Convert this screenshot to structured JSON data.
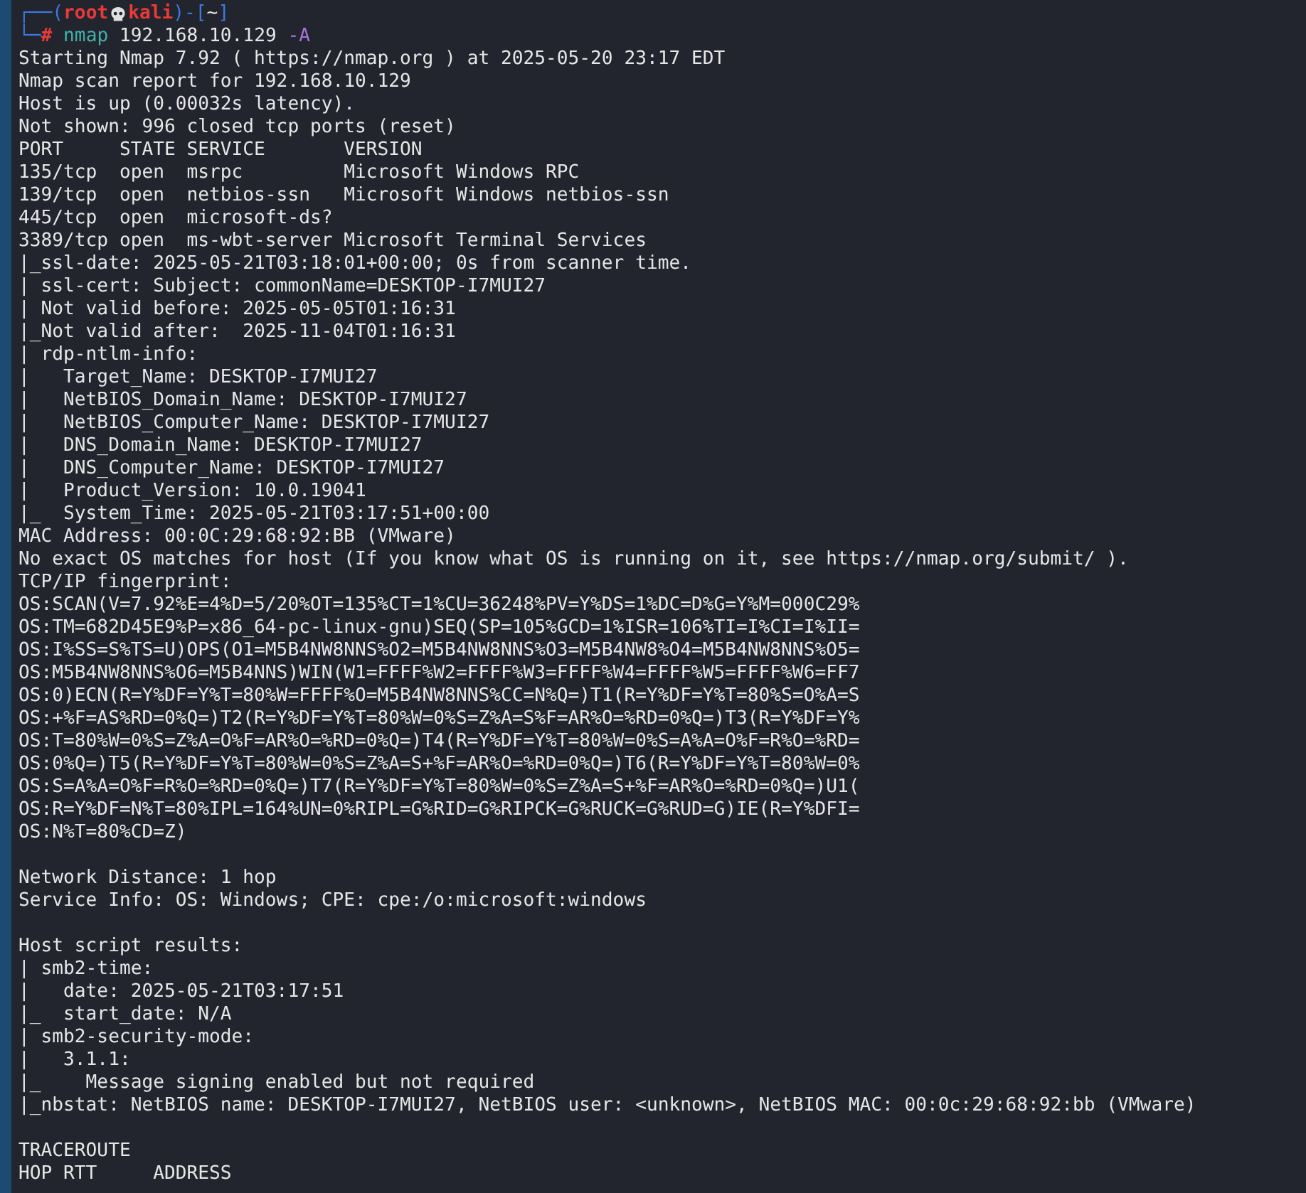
{
  "terminal": {
    "lines": [
      {
        "kind": "prompt",
        "segments": [
          {
            "kind": "frame",
            "text": "┌──("
          },
          {
            "kind": "user",
            "text": "root"
          },
          {
            "kind": "skull"
          },
          {
            "kind": "host",
            "text": "kali"
          },
          {
            "kind": "frame",
            "text": ")-["
          },
          {
            "kind": "directory",
            "text": "~"
          },
          {
            "kind": "frame",
            "text": "]"
          }
        ]
      },
      {
        "kind": "prompt",
        "segments": [
          {
            "kind": "frame",
            "text": "└─"
          },
          {
            "kind": "symbol",
            "text": "#"
          },
          {
            "kind": "program",
            "text": "nmap"
          },
          {
            "kind": "argument",
            "text": "192.168.10.129"
          },
          {
            "kind": "flag",
            "text": "-A"
          }
        ]
      },
      {
        "kind": "output",
        "text": "Starting Nmap 7.92 ( https://nmap.org ) at 2025-05-20 23:17 EDT"
      },
      {
        "kind": "output",
        "text": "Nmap scan report for 192.168.10.129"
      },
      {
        "kind": "output",
        "text": "Host is up (0.00032s latency)."
      },
      {
        "kind": "output",
        "text": "Not shown: 996 closed tcp ports (reset)"
      },
      {
        "kind": "output",
        "text": "PORT     STATE SERVICE       VERSION"
      },
      {
        "kind": "output",
        "text": "135/tcp  open  msrpc         Microsoft Windows RPC"
      },
      {
        "kind": "output",
        "text": "139/tcp  open  netbios-ssn   Microsoft Windows netbios-ssn"
      },
      {
        "kind": "output",
        "text": "445/tcp  open  microsoft-ds?"
      },
      {
        "kind": "output",
        "text": "3389/tcp open  ms-wbt-server Microsoft Terminal Services"
      },
      {
        "kind": "output",
        "text": "|_ssl-date: 2025-05-21T03:18:01+00:00; 0s from scanner time."
      },
      {
        "kind": "output",
        "text": "| ssl-cert: Subject: commonName=DESKTOP-I7MUI27"
      },
      {
        "kind": "output",
        "text": "| Not valid before: 2025-05-05T01:16:31"
      },
      {
        "kind": "output",
        "text": "|_Not valid after:  2025-11-04T01:16:31"
      },
      {
        "kind": "output",
        "text": "| rdp-ntlm-info:"
      },
      {
        "kind": "output",
        "text": "|   Target_Name: DESKTOP-I7MUI27"
      },
      {
        "kind": "output",
        "text": "|   NetBIOS_Domain_Name: DESKTOP-I7MUI27"
      },
      {
        "kind": "output",
        "text": "|   NetBIOS_Computer_Name: DESKTOP-I7MUI27"
      },
      {
        "kind": "output",
        "text": "|   DNS_Domain_Name: DESKTOP-I7MUI27"
      },
      {
        "kind": "output",
        "text": "|   DNS_Computer_Name: DESKTOP-I7MUI27"
      },
      {
        "kind": "output",
        "text": "|   Product_Version: 10.0.19041"
      },
      {
        "kind": "output",
        "text": "|_  System_Time: 2025-05-21T03:17:51+00:00"
      },
      {
        "kind": "output",
        "text": "MAC Address: 00:0C:29:68:92:BB (VMware)"
      },
      {
        "kind": "output",
        "text": "No exact OS matches for host (If you know what OS is running on it, see https://nmap.org/submit/ )."
      },
      {
        "kind": "output",
        "text": "TCP/IP fingerprint:"
      },
      {
        "kind": "output",
        "text": "OS:SCAN(V=7.92%E=4%D=5/20%OT=135%CT=1%CU=36248%PV=Y%DS=1%DC=D%G=Y%M=000C29%"
      },
      {
        "kind": "output",
        "text": "OS:TM=682D45E9%P=x86_64-pc-linux-gnu)SEQ(SP=105%GCD=1%ISR=106%TI=I%CI=I%II="
      },
      {
        "kind": "output",
        "text": "OS:I%SS=S%TS=U)OPS(O1=M5B4NW8NNS%O2=M5B4NW8NNS%O3=M5B4NW8%O4=M5B4NW8NNS%O5="
      },
      {
        "kind": "output",
        "text": "OS:M5B4NW8NNS%O6=M5B4NNS)WIN(W1=FFFF%W2=FFFF%W3=FFFF%W4=FFFF%W5=FFFF%W6=FF7"
      },
      {
        "kind": "output",
        "text": "OS:0)ECN(R=Y%DF=Y%T=80%W=FFFF%O=M5B4NW8NNS%CC=N%Q=)T1(R=Y%DF=Y%T=80%S=O%A=S"
      },
      {
        "kind": "output",
        "text": "OS:+%F=AS%RD=0%Q=)T2(R=Y%DF=Y%T=80%W=0%S=Z%A=S%F=AR%O=%RD=0%Q=)T3(R=Y%DF=Y%"
      },
      {
        "kind": "output",
        "text": "OS:T=80%W=0%S=Z%A=O%F=AR%O=%RD=0%Q=)T4(R=Y%DF=Y%T=80%W=0%S=A%A=O%F=R%O=%RD="
      },
      {
        "kind": "output",
        "text": "OS:0%Q=)T5(R=Y%DF=Y%T=80%W=0%S=Z%A=S+%F=AR%O=%RD=0%Q=)T6(R=Y%DF=Y%T=80%W=0%"
      },
      {
        "kind": "output",
        "text": "OS:S=A%A=O%F=R%O=%RD=0%Q=)T7(R=Y%DF=Y%T=80%W=0%S=Z%A=S+%F=AR%O=%RD=0%Q=)U1("
      },
      {
        "kind": "output",
        "text": "OS:R=Y%DF=N%T=80%IPL=164%UN=0%RIPL=G%RID=G%RIPCK=G%RUCK=G%RUD=G)IE(R=Y%DFI="
      },
      {
        "kind": "output",
        "text": "OS:N%T=80%CD=Z)"
      },
      {
        "kind": "blank"
      },
      {
        "kind": "output",
        "text": "Network Distance: 1 hop"
      },
      {
        "kind": "output",
        "text": "Service Info: OS: Windows; CPE: cpe:/o:microsoft:windows"
      },
      {
        "kind": "blank"
      },
      {
        "kind": "output",
        "text": "Host script results:"
      },
      {
        "kind": "output",
        "text": "| smb2-time:"
      },
      {
        "kind": "output",
        "text": "|   date: 2025-05-21T03:17:51"
      },
      {
        "kind": "output",
        "text": "|_  start_date: N/A"
      },
      {
        "kind": "output",
        "text": "| smb2-security-mode:"
      },
      {
        "kind": "output",
        "text": "|   3.1.1:"
      },
      {
        "kind": "output",
        "text": "|_    Message signing enabled but not required"
      },
      {
        "kind": "output",
        "text": "|_nbstat: NetBIOS name: DESKTOP-I7MUI27, NetBIOS user: <unknown>, NetBIOS MAC: 00:0c:29:68:92:bb (VMware)"
      },
      {
        "kind": "blank"
      },
      {
        "kind": "output",
        "text": "TRACEROUTE"
      },
      {
        "kind": "output",
        "text": "HOP RTT     ADDRESS"
      }
    ]
  }
}
